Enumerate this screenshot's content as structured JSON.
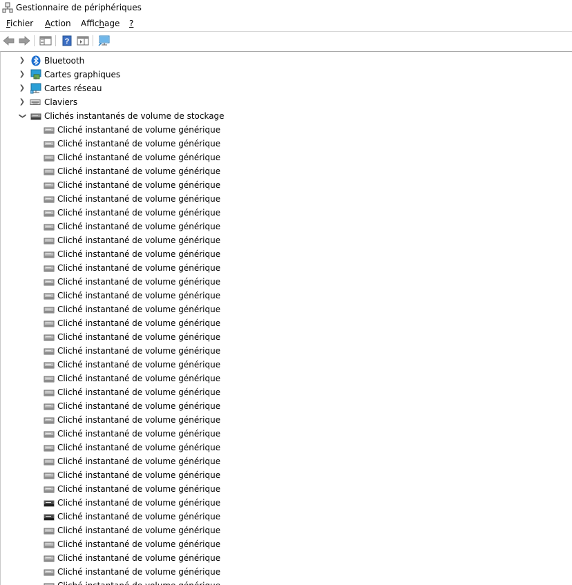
{
  "window": {
    "title": "Gestionnaire de périphériques"
  },
  "menu": {
    "items": [
      {
        "pre": "",
        "u": "F",
        "post": "ichier"
      },
      {
        "pre": "",
        "u": "A",
        "post": "ction"
      },
      {
        "pre": "Affic",
        "u": "h",
        "post": "age"
      },
      {
        "pre": "",
        "u": "?",
        "post": ""
      }
    ]
  },
  "toolbar": {
    "buttons": [
      "back-arrow-icon",
      "forward-arrow-icon",
      "show-hide-console-tree-icon",
      "help-icon",
      "action-pane-icon",
      "scan-hardware-changes-icon"
    ]
  },
  "tree": {
    "categories": [
      {
        "label": "Bluetooth",
        "icon": "bluetooth-icon",
        "expanded": false
      },
      {
        "label": "Cartes graphiques",
        "icon": "display-adapter-icon",
        "expanded": false
      },
      {
        "label": "Cartes réseau",
        "icon": "network-adapter-icon",
        "expanded": false
      },
      {
        "label": "Claviers",
        "icon": "keyboard-icon",
        "expanded": false
      },
      {
        "label": "Clichés instantanés de volume de stockage",
        "icon": "storage-volume-icon",
        "expanded": true
      }
    ],
    "children": [
      "Cliché instantané de volume générique",
      "Cliché instantané de volume générique",
      "Cliché instantané de volume générique",
      "Cliché instantané de volume générique",
      "Cliché instantané de volume générique",
      "Cliché instantané de volume générique",
      "Cliché instantané de volume générique",
      "Cliché instantané de volume générique",
      "Cliché instantané de volume générique",
      "Cliché instantané de volume générique",
      "Cliché instantané de volume générique",
      "Cliché instantané de volume générique",
      "Cliché instantané de volume générique",
      "Cliché instantané de volume générique",
      "Cliché instantané de volume générique",
      "Cliché instantané de volume générique",
      "Cliché instantané de volume générique",
      "Cliché instantané de volume générique",
      "Cliché instantané de volume générique",
      "Cliché instantané de volume générique",
      "Cliché instantané de volume générique",
      "Cliché instantané de volume générique",
      "Cliché instantané de volume générique",
      "Cliché instantané de volume générique",
      "Cliché instantané de volume générique",
      "Cliché instantané de volume générique",
      "Cliché instantané de volume générique",
      "Cliché instantané de volume générique",
      "Cliché instantané de volume générique",
      "Cliché instantané de volume générique",
      "Cliché instantané de volume générique",
      "Cliché instantané de volume générique",
      "Cliché instantané de volume générique",
      "Cliché instantané de volume générique"
    ],
    "child_icons": [
      "volume-light-icon",
      "volume-light-icon",
      "volume-light-icon",
      "volume-light-icon",
      "volume-light-icon",
      "volume-light-icon",
      "volume-light-icon",
      "volume-light-icon",
      "volume-light-icon",
      "volume-light-icon",
      "volume-light-icon",
      "volume-light-icon",
      "volume-light-icon",
      "volume-light-icon",
      "volume-light-icon",
      "volume-light-icon",
      "volume-light-icon",
      "volume-light-icon",
      "volume-light-icon",
      "volume-light-icon",
      "volume-light-icon",
      "volume-light-icon",
      "volume-light-icon",
      "volume-light-icon",
      "volume-light-icon",
      "volume-light-icon",
      "volume-light-icon",
      "volume-dark-icon",
      "volume-dark-icon",
      "volume-light-icon",
      "volume-light-icon",
      "volume-light-icon",
      "volume-light-icon",
      "volume-light-icon"
    ]
  },
  "colors": {
    "accent_blue": "#1e6fd0",
    "monitor_teal": "#2a9fd6"
  }
}
